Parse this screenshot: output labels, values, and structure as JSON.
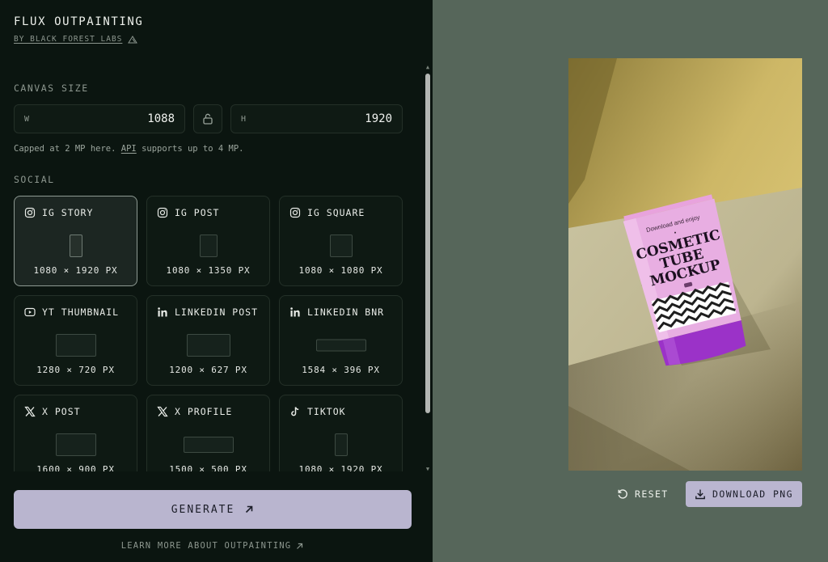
{
  "brand": {
    "title": "FLUX OUTPAINTING",
    "subtitle": "BY BLACK FOREST LABS"
  },
  "canvas": {
    "section_label": "CANVAS SIZE",
    "width_label": "W",
    "width_value": "1088",
    "height_label": "H",
    "height_value": "1920",
    "note_prefix": "Capped at 2 MP here.",
    "note_link": "API",
    "note_suffix": "supports up to 4 MP."
  },
  "social": {
    "section_label": "SOCIAL",
    "presets": [
      {
        "name": "IG STORY",
        "size": "1080 × 1920 PX",
        "icon": "instagram-icon"
      },
      {
        "name": "IG POST",
        "size": "1080 × 1350 PX",
        "icon": "instagram-icon"
      },
      {
        "name": "IG SQUARE",
        "size": "1080 × 1080 PX",
        "icon": "instagram-icon"
      },
      {
        "name": "YT THUMBNAIL",
        "size": "1280 × 720 PX",
        "icon": "youtube-icon"
      },
      {
        "name": "LINKEDIN POST",
        "size": "1200 × 627 PX",
        "icon": "linkedin-icon"
      },
      {
        "name": "LINKEDIN BNR",
        "size": "1584 × 396 PX",
        "icon": "linkedin-icon"
      },
      {
        "name": "X POST",
        "size": "1600 × 900 PX",
        "icon": "x-icon"
      },
      {
        "name": "X PROFILE",
        "size": "1500 × 500 PX",
        "icon": "x-icon"
      },
      {
        "name": "TIKTOK",
        "size": "1080 × 1920 PX",
        "icon": "tiktok-icon"
      }
    ],
    "selected": "IG STORY"
  },
  "actions": {
    "generate": "GENERATE",
    "learn_more": "LEARN MORE ABOUT OUTPAINTING",
    "reset": "RESET",
    "download": "DOWNLOAD PNG"
  },
  "preview": {
    "tube_tagline": "Download and enjoy",
    "tube_title_1": "COSMETIC",
    "tube_title_2": "TUBE",
    "tube_title_3": "MOCKUP"
  },
  "colors": {
    "sidebar_bg": "#0b1510",
    "canvas_bg": "#56665a",
    "accent": "#b9b5cf"
  }
}
